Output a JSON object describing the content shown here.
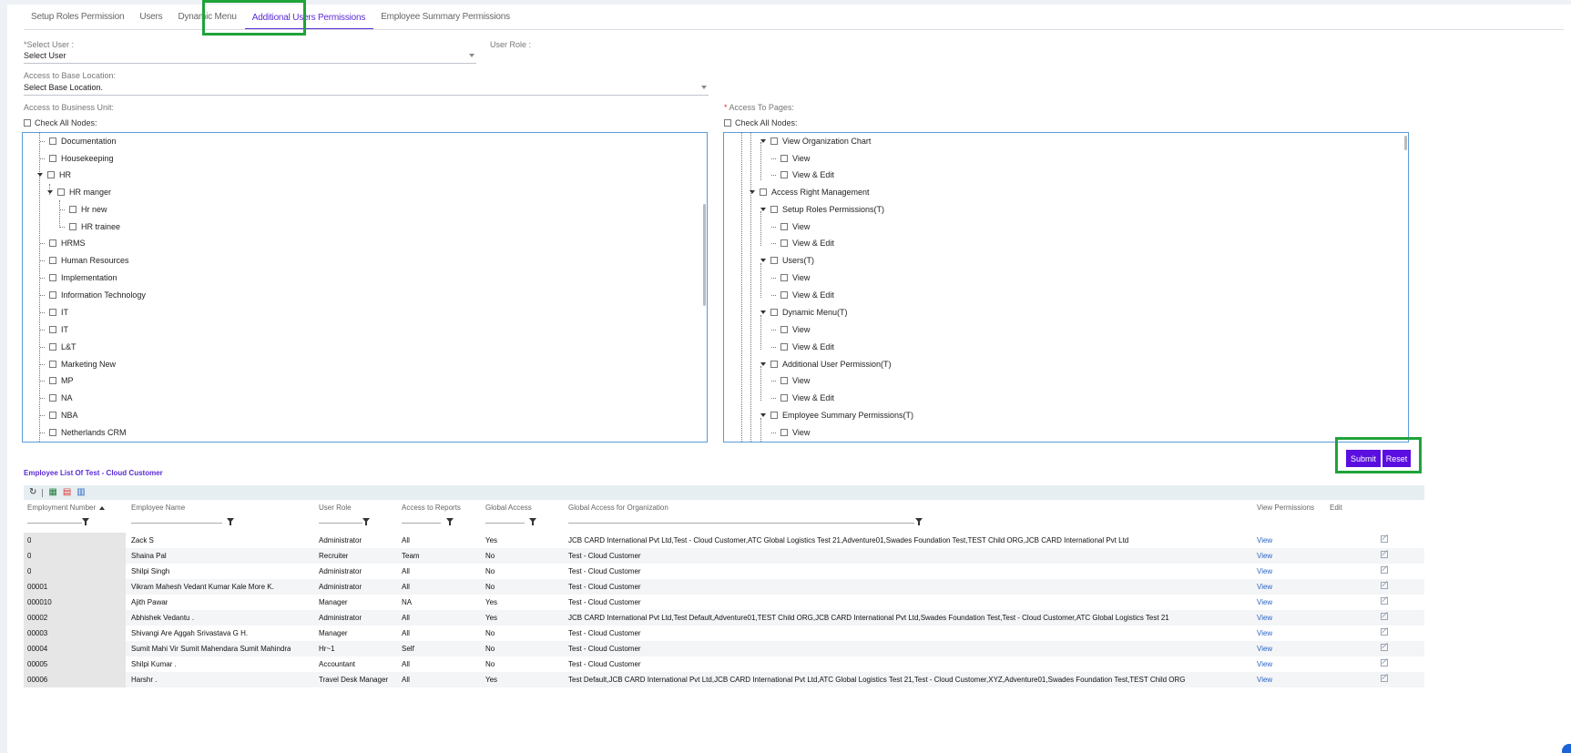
{
  "tabs": [
    {
      "label": "Setup Roles Permission"
    },
    {
      "label": "Users"
    },
    {
      "label": "Dynamic Menu"
    },
    {
      "label": "Additional Users Permissions",
      "active": true
    },
    {
      "label": "Employee Summary Permissions"
    }
  ],
  "form": {
    "select_user_label": "*Select User :",
    "select_user_value": "Select User",
    "user_role_label": "User Role :",
    "base_location_label": "Access to Base Location:",
    "base_location_value": "Select Base Location.",
    "business_unit_label": "Access to Business Unit:",
    "access_pages_label": "* Access To Pages:",
    "check_all_left": "Check All Nodes:",
    "check_all_right": "Check All Nodes:"
  },
  "business_tree": [
    "Documentation",
    "Housekeeping",
    "HR",
    "HR manger",
    "Hr new",
    "HR trainee",
    "HRMS",
    "Human Resources",
    "Implementation",
    "Information Technology",
    "IT",
    "IT",
    "L&T",
    "Marketing New",
    "MP",
    "NA",
    "NBA",
    "Netherlands CRM"
  ],
  "pages_tree": [
    "View Organization Chart",
    "View",
    "View & Edit",
    "Access Right Management",
    "Setup Roles Permissions(T)",
    "View",
    "View & Edit",
    "Users(T)",
    "View",
    "View & Edit",
    "Dynamic Menu(T)",
    "View",
    "View & Edit",
    "Additional User Permission(T)",
    "View",
    "View & Edit",
    "Employee Summary Permissions(T)",
    "View"
  ],
  "buttons": {
    "submit": "Submit",
    "reset": "Reset"
  },
  "employee_list": {
    "title": "Employee List Of Test - Cloud Customer",
    "toolbar_icons": [
      "refresh-icon",
      "excel-icon",
      "pdf-icon",
      "word-icon"
    ],
    "columns": [
      "Employment Number",
      "Employee Name",
      "User Role",
      "Access to Reports",
      "Global Access",
      "Global Access for Organization",
      "View Permissions",
      "Edit"
    ],
    "rows": [
      [
        "0",
        "Zack S",
        "Administrator",
        "All",
        "Yes",
        "JCB CARD International Pvt Ltd,Test - Cloud Customer,ATC Global Logistics Test 21,Adventure01,Swades Foundation Test,TEST Child ORG,JCB CARD International Pvt Ltd",
        "View"
      ],
      [
        "0",
        "Shaina Pal",
        "Recruiter",
        "Team",
        "No",
        "Test - Cloud Customer",
        "View"
      ],
      [
        "0",
        "Shilpi Singh",
        "Administrator",
        "All",
        "No",
        "Test - Cloud Customer",
        "View"
      ],
      [
        "00001",
        "Vikram Mahesh Vedant Kumar Kale More K.",
        "Administrator",
        "All",
        "No",
        "Test - Cloud Customer",
        "View"
      ],
      [
        "000010",
        "Ajith Pawar",
        "Manager",
        "NA",
        "Yes",
        "Test - Cloud Customer",
        "View"
      ],
      [
        "00002",
        "Abhishek Vedantu .",
        "Administrator",
        "All",
        "Yes",
        "JCB CARD International Pvt Ltd,Test Default,Adventure01,TEST Child ORG,JCB CARD International Pvt Ltd,Swades Foundation Test,Test - Cloud Customer,ATC Global Logistics Test 21",
        "View"
      ],
      [
        "00003",
        "Shivangi Are Aggah Srivastava G H.",
        "Manager",
        "All",
        "No",
        "Test - Cloud Customer",
        "View"
      ],
      [
        "00004",
        "Sumit Mahi Vir Sumit Mahendara Sumit Mahindra",
        "Hr~1",
        "Self",
        "No",
        "Test - Cloud Customer",
        "View"
      ],
      [
        "00005",
        "Shilpi Kumar .",
        "Accountant",
        "All",
        "No",
        "Test - Cloud Customer",
        "View"
      ],
      [
        "00006",
        "Harshr .",
        "Travel Desk Manager",
        "All",
        "Yes",
        "Test Default,JCB CARD International Pvt Ltd,JCB CARD International Pvt Ltd,ATC Global Logistics Test 21,Test - Cloud Customer,XYZ,Adventure01,Swades Foundation Test,TEST Child ORG",
        "View"
      ]
    ]
  },
  "colors": {
    "accent": "#5b0ee0",
    "tab_active": "#5b2bd6",
    "highlight": "#1fa33a",
    "tree_border": "#5a9ad8",
    "link": "#2a64c5"
  }
}
